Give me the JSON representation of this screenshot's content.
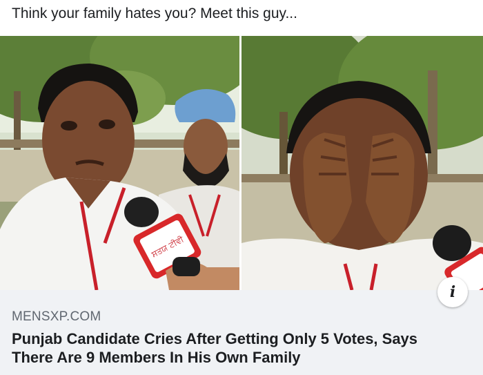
{
  "post": {
    "text": "Think your family hates you? Meet this guy..."
  },
  "media": {
    "left_frame": "video-still-candidate-with-microphone",
    "right_frame": "video-still-candidate-covering-face",
    "mic_brand_text": "ਸਤਯ ਟੀਵੀ",
    "info_icon": "info-icon"
  },
  "link": {
    "domain": "MENSXP.COM",
    "headline_line1": "Punjab Candidate Cries After Getting Only 5 Votes, Says",
    "headline_line2": "There Are 9 Members In His Own Family"
  },
  "colors": {
    "preview_background": "#f0f2f5",
    "domain_text": "#606770",
    "headline_text": "#1c1e21",
    "lanyard_red": "#c8202a"
  }
}
